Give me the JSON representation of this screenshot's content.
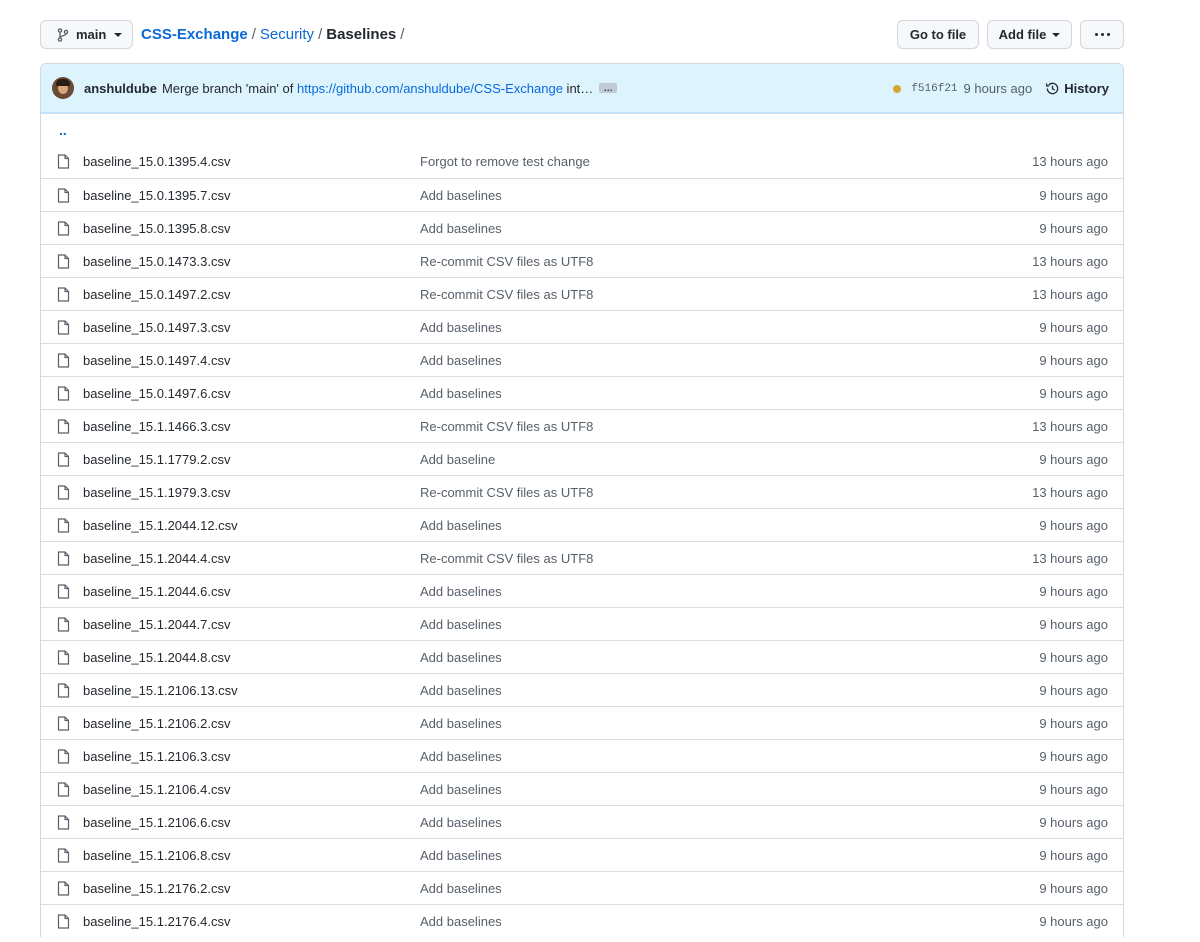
{
  "toolbar": {
    "branch_label": "main",
    "breadcrumb": {
      "repo": "CSS-Exchange",
      "folder": "Security",
      "current": "Baselines",
      "separator": "/"
    },
    "go_to_file_label": "Go to file",
    "add_file_label": "Add file"
  },
  "commit": {
    "author": "anshuldube",
    "message_prefix": "Merge branch 'main' of ",
    "message_link": "https://github.com/anshuldube/CSS-Exchange",
    "message_suffix": " int…",
    "ellipsis": "…",
    "status_color": "#d4a72c",
    "sha": "f516f21",
    "time": "9 hours ago",
    "history_label": "History"
  },
  "parent_dir_label": "..",
  "files": [
    {
      "name": "baseline_15.0.1395.4.csv",
      "message": "Forgot to remove test change",
      "age": "13 hours ago"
    },
    {
      "name": "baseline_15.0.1395.7.csv",
      "message": "Add baselines",
      "age": "9 hours ago"
    },
    {
      "name": "baseline_15.0.1395.8.csv",
      "message": "Add baselines",
      "age": "9 hours ago"
    },
    {
      "name": "baseline_15.0.1473.3.csv",
      "message": "Re-commit CSV files as UTF8",
      "age": "13 hours ago"
    },
    {
      "name": "baseline_15.0.1497.2.csv",
      "message": "Re-commit CSV files as UTF8",
      "age": "13 hours ago"
    },
    {
      "name": "baseline_15.0.1497.3.csv",
      "message": "Add baselines",
      "age": "9 hours ago"
    },
    {
      "name": "baseline_15.0.1497.4.csv",
      "message": "Add baselines",
      "age": "9 hours ago"
    },
    {
      "name": "baseline_15.0.1497.6.csv",
      "message": "Add baselines",
      "age": "9 hours ago"
    },
    {
      "name": "baseline_15.1.1466.3.csv",
      "message": "Re-commit CSV files as UTF8",
      "age": "13 hours ago"
    },
    {
      "name": "baseline_15.1.1779.2.csv",
      "message": "Add baseline",
      "age": "9 hours ago"
    },
    {
      "name": "baseline_15.1.1979.3.csv",
      "message": "Re-commit CSV files as UTF8",
      "age": "13 hours ago"
    },
    {
      "name": "baseline_15.1.2044.12.csv",
      "message": "Add baselines",
      "age": "9 hours ago"
    },
    {
      "name": "baseline_15.1.2044.4.csv",
      "message": "Re-commit CSV files as UTF8",
      "age": "13 hours ago"
    },
    {
      "name": "baseline_15.1.2044.6.csv",
      "message": "Add baselines",
      "age": "9 hours ago"
    },
    {
      "name": "baseline_15.1.2044.7.csv",
      "message": "Add baselines",
      "age": "9 hours ago"
    },
    {
      "name": "baseline_15.1.2044.8.csv",
      "message": "Add baselines",
      "age": "9 hours ago"
    },
    {
      "name": "baseline_15.1.2106.13.csv",
      "message": "Add baselines",
      "age": "9 hours ago"
    },
    {
      "name": "baseline_15.1.2106.2.csv",
      "message": "Add baselines",
      "age": "9 hours ago"
    },
    {
      "name": "baseline_15.1.2106.3.csv",
      "message": "Add baselines",
      "age": "9 hours ago"
    },
    {
      "name": "baseline_15.1.2106.4.csv",
      "message": "Add baselines",
      "age": "9 hours ago"
    },
    {
      "name": "baseline_15.1.2106.6.csv",
      "message": "Add baselines",
      "age": "9 hours ago"
    },
    {
      "name": "baseline_15.1.2106.8.csv",
      "message": "Add baselines",
      "age": "9 hours ago"
    },
    {
      "name": "baseline_15.1.2176.2.csv",
      "message": "Add baselines",
      "age": "9 hours ago"
    },
    {
      "name": "baseline_15.1.2176.4.csv",
      "message": "Add baselines",
      "age": "9 hours ago"
    }
  ]
}
